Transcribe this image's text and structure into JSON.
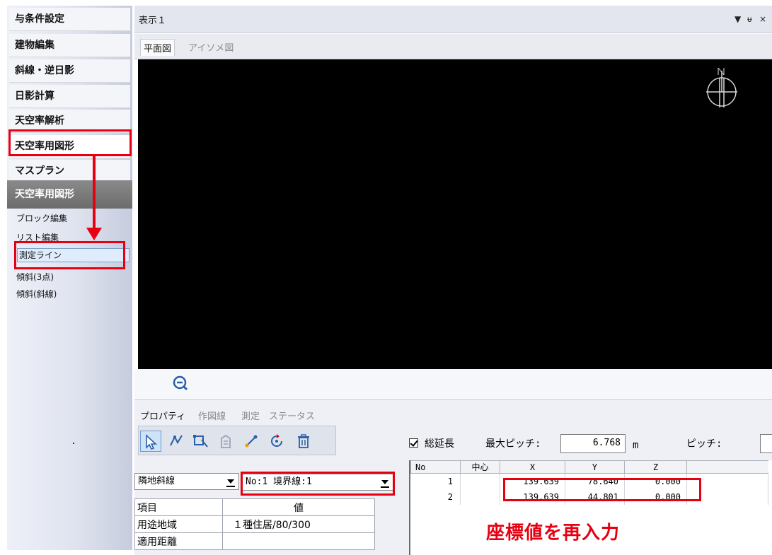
{
  "sidebar": {
    "items": [
      {
        "label": "与条件設定"
      },
      {
        "label": "建物編集"
      },
      {
        "label": "斜線・逆日影"
      },
      {
        "label": "日影計算"
      },
      {
        "label": "天空率解析"
      },
      {
        "label": "天空率用図形"
      },
      {
        "label": "マスプラン"
      }
    ],
    "panel_title": "天空率用図形",
    "sub_items": [
      {
        "label": "ブロック編集"
      },
      {
        "label": "リスト編集"
      },
      {
        "label": "測定ライン"
      },
      {
        "label": "傾斜(3点)"
      },
      {
        "label": "傾斜(斜線)"
      }
    ]
  },
  "view": {
    "title": "表示１",
    "controls": {
      "dropdown": "▼",
      "pin": "ᵾ",
      "close": "×"
    },
    "tabs": [
      {
        "label": "平面図"
      },
      {
        "label": "アイソメ図"
      }
    ]
  },
  "properties": {
    "tabs": [
      {
        "label": "プロパティ"
      },
      {
        "label": "作図線"
      },
      {
        "label": "測定"
      },
      {
        "label": "ステータス"
      }
    ],
    "type_select": "隣地斜線",
    "line_select": "No:1 境界線:1",
    "table": {
      "headers": [
        "項目",
        "値"
      ],
      "rows": [
        [
          "用途地域",
          "１種住居/80/300"
        ],
        [
          "適用距離",
          ""
        ]
      ]
    }
  },
  "coordinates": {
    "total_length_label": "総延長",
    "total_length_checked": true,
    "max_pitch_label": "最大ピッチ:",
    "max_pitch_value": "6.768",
    "max_pitch_unit": "m",
    "pitch_label": "ピッチ:",
    "headers": [
      "No",
      "中心",
      "X",
      "Y",
      "Z"
    ],
    "rows": [
      {
        "no": "1",
        "center": "",
        "x": "139.639",
        "y": "78.640",
        "z": "0.000"
      },
      {
        "no": "2",
        "center": "",
        "x": "139.639",
        "y": "44.801",
        "z": "0.000"
      }
    ]
  },
  "annotation": {
    "text": "座標値を再入力",
    "color": "#e60012"
  }
}
